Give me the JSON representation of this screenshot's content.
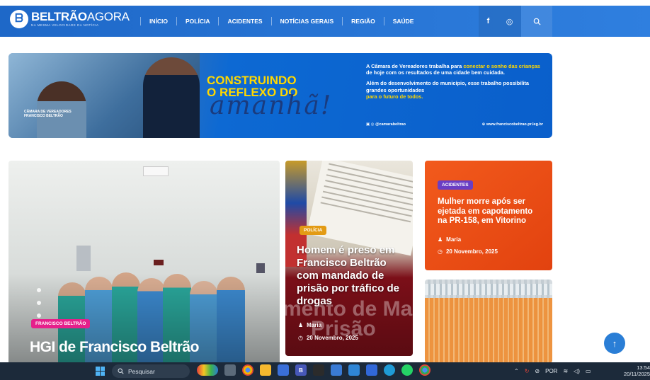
{
  "header": {
    "brand_bold": "BELTRÃO",
    "brand_light": "AGORA",
    "brand_tagline": "NA MESMA VELOCIDADE DA NOTÍCIA",
    "nav": [
      "INÍCIO",
      "POLÍCIA",
      "ACIDENTES",
      "NOTÍCIAS GERAIS",
      "REGIÃO",
      "SAÚDE"
    ],
    "social": [
      "f",
      "◎"
    ],
    "icons": [
      "facebook-icon",
      "instagram-icon",
      "search-icon"
    ],
    "colors": {
      "navbar": "#1e68c8",
      "accent": "#ffd800"
    }
  },
  "banner": {
    "headline_1": "CONSTRUINDO",
    "headline_2": "O REFLEXO DO",
    "script": "amanhã!",
    "seal": "CÂMARA DE VEREADORES FRANCISCO BELTRÃO",
    "copy_1_pre": "A Câmara de Vereadores  trabalha para ",
    "copy_1_hl1": "conectar o",
    "copy_1_hl2": "sonho das crianças",
    "copy_1_post": " de hoje com os resultados de uma cidade bem cuidada.",
    "copy_2": "Além do desenvolvimento do município, esse trabalho possibilita grandes oportunidades",
    "copy_2_hl": "para o futuro de todos.",
    "handle": "@camarabeltrao",
    "site": "www.franciscobeltrao.pr.leg.br"
  },
  "featured": {
    "tag": "FRANCISCO BELTRÃO",
    "title": "HGI de Francisco Beltrão"
  },
  "police_story": {
    "tag": "POLÍCIA",
    "title": "Homem é preso em Francisco Beltrão com mandado de prisão por tráfico de drogas",
    "watermark_1": "mento de Man",
    "watermark_2": "Prisão",
    "author": "Maria",
    "date": "20 Novembro, 2025"
  },
  "accident_story": {
    "tag": "ACIDENTES",
    "title": "Mulher morre após ser ejetada em capotamento na PR-158, em Vitorino",
    "author": "Maria",
    "date": "20 Novembro, 2025"
  },
  "taskbar": {
    "search_placeholder": "Pesquisar",
    "language": "POR",
    "time": "13:54",
    "date": "20/11/2025"
  }
}
